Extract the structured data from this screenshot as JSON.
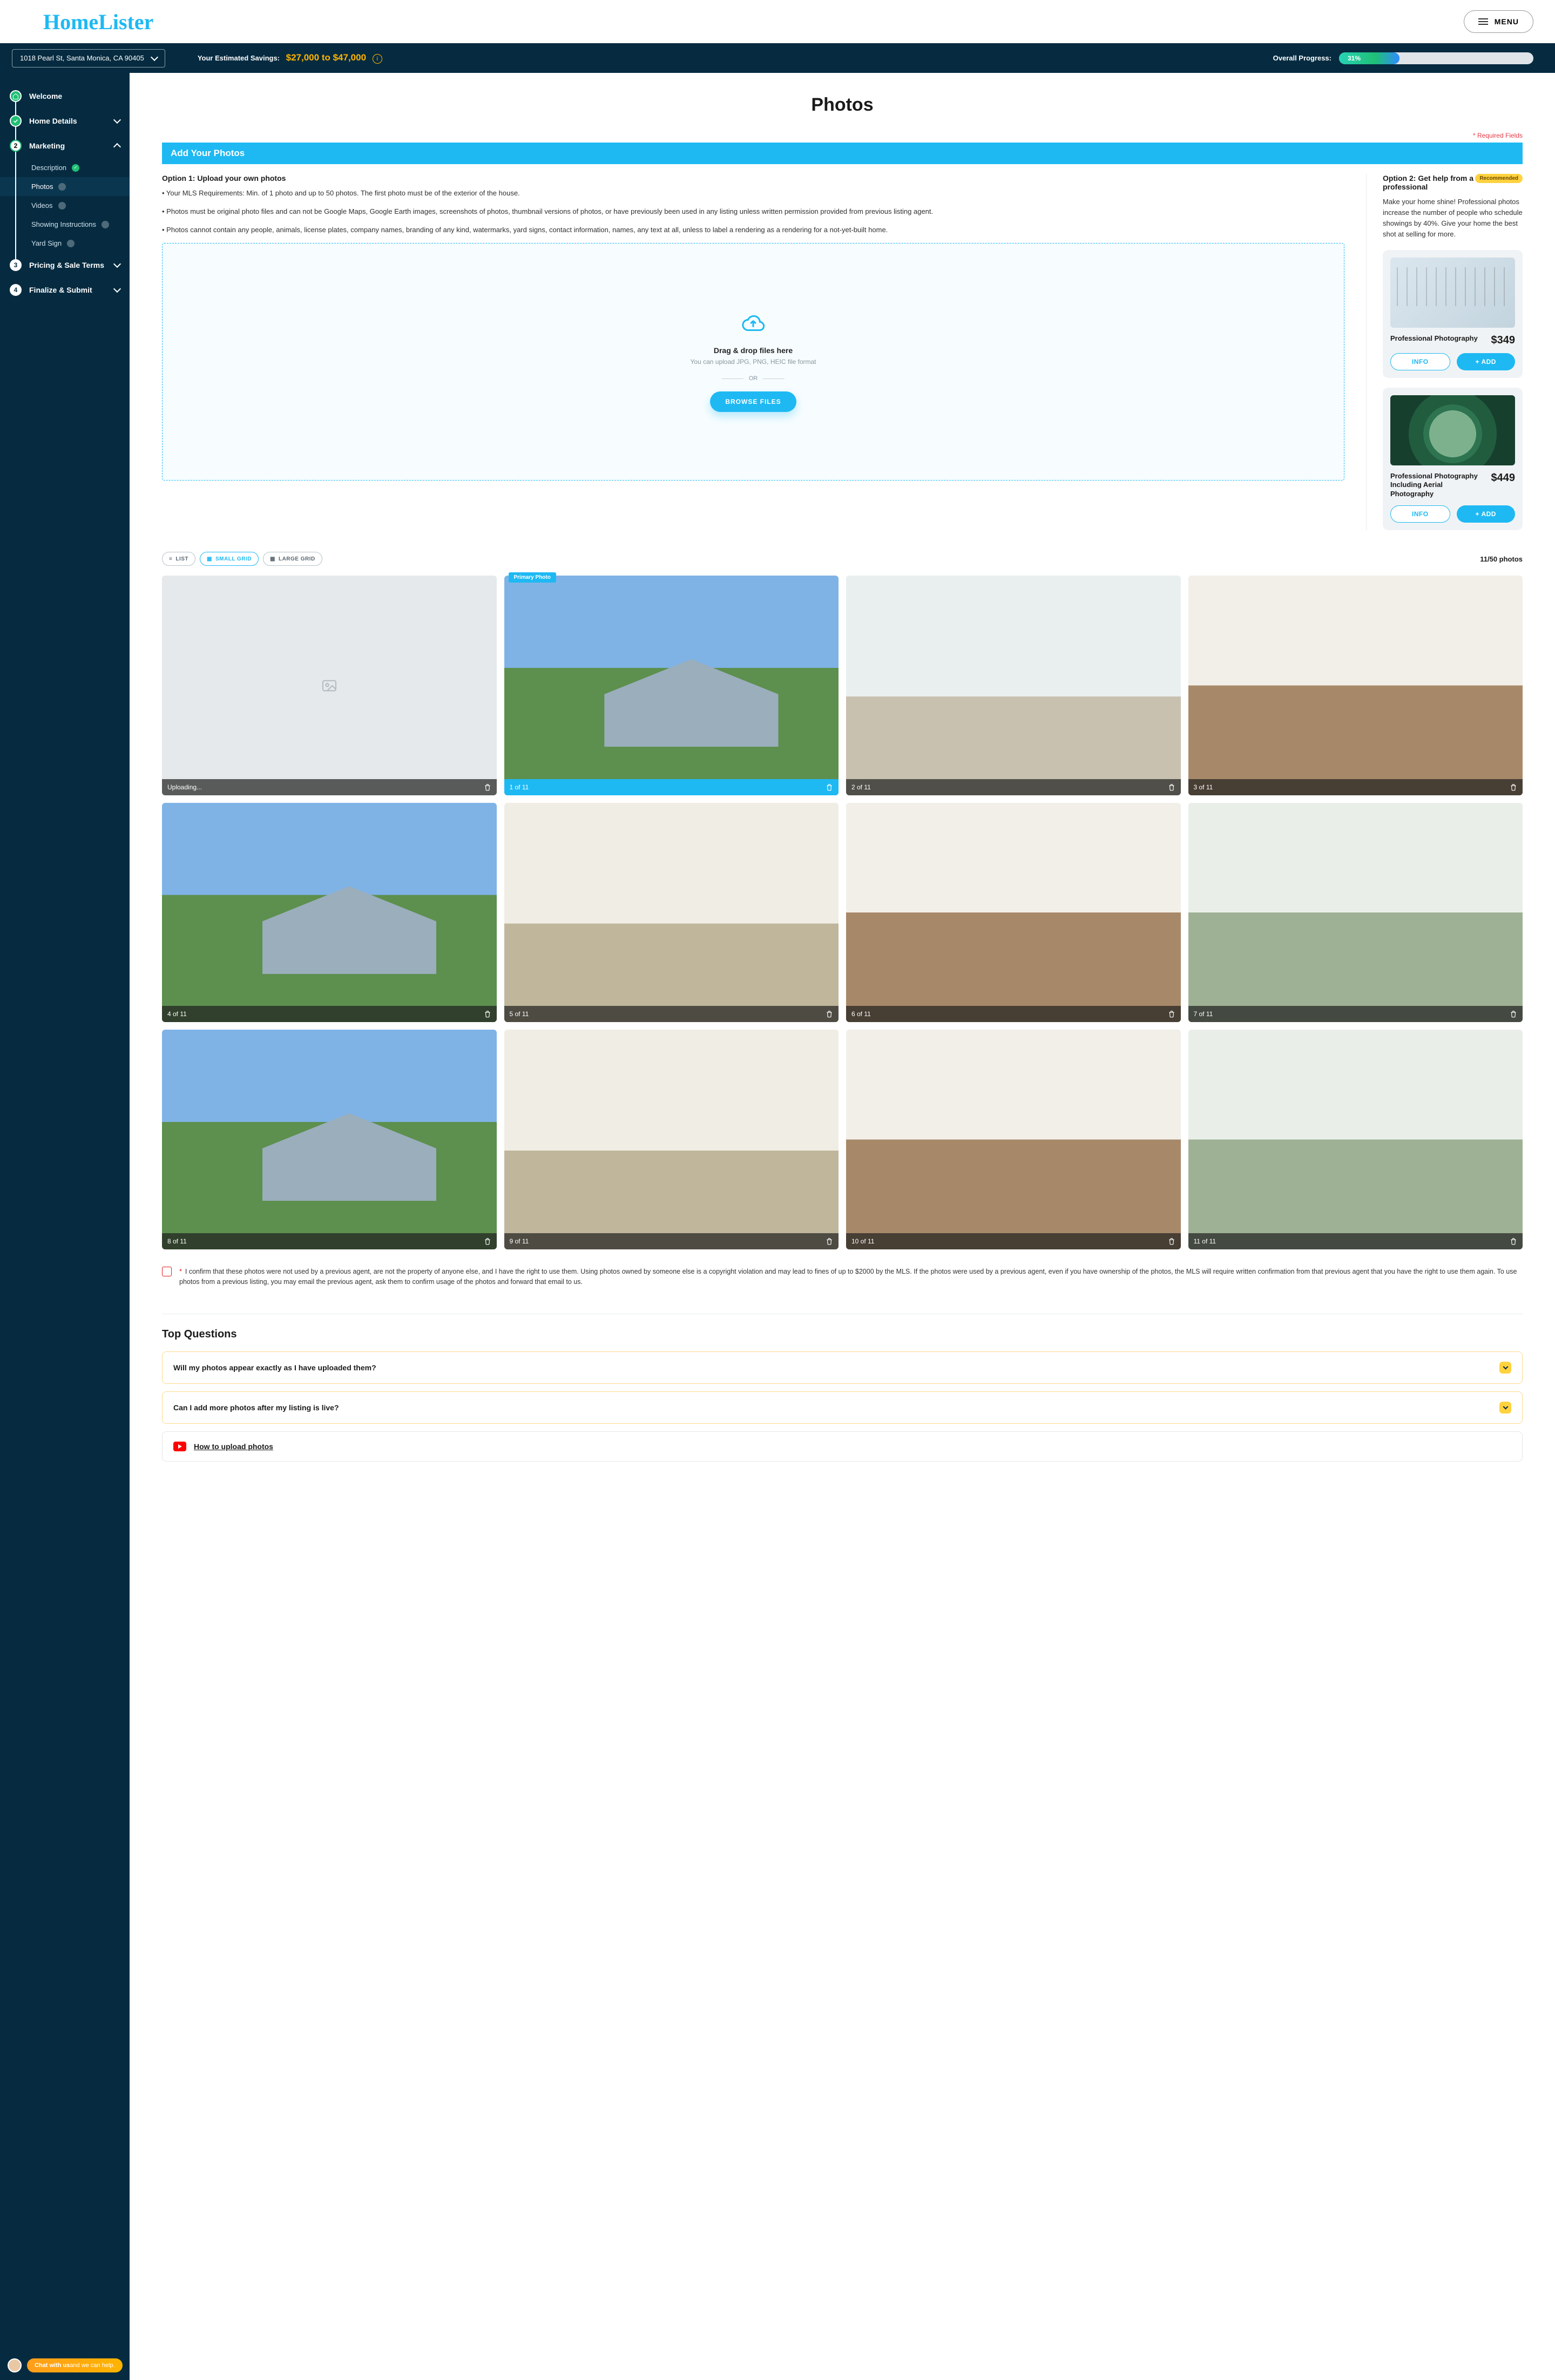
{
  "header": {
    "logo": "HomeLister",
    "menu": "MENU"
  },
  "subheader": {
    "address": "1018 Pearl St, Santa Monica, CA 90405",
    "savings_label": "Your Estimated Savings:",
    "savings_value": "$27,000 to $47,000",
    "progress_label": "Overall Progress:",
    "progress_percent": "31%",
    "progress_width": "31%"
  },
  "sidebar": {
    "steps": {
      "welcome": "Welcome",
      "home_details": "Home Details",
      "marketing": "Marketing",
      "pricing": "Pricing & Sale Terms",
      "finalize": "Finalize & Submit",
      "n3": "3",
      "n4": "4",
      "n2": "2"
    },
    "sub": {
      "description": "Description",
      "photos": "Photos",
      "videos": "Videos",
      "showing": "Showing Instructions",
      "yard": "Yard Sign"
    }
  },
  "page": {
    "title": "Photos",
    "required": "* Required Fields",
    "section": "Add Your Photos"
  },
  "option1": {
    "title": "Option 1: Upload your own photos",
    "p1": "• Your MLS Requirements: Min. of 1 photo and up to 50 photos. The first photo must be of the exterior of the house.",
    "p2": "• Photos must be original photo files and can not be Google Maps, Google Earth images, screenshots of photos, thumbnail versions of photos, or have previously been used in any listing unless written permission provided from previous listing agent.",
    "p3": "• Photos cannot contain any people, animals, license plates, company names, branding of any kind, watermarks, yard signs, contact information, names, any text at all, unless to label a rendering as a rendering for a not-yet-built home."
  },
  "upload": {
    "title": "Drag & drop files here",
    "sub": "You can upload JPG, PNG, HEIC file format",
    "or": "OR",
    "browse": "BROWSE FILES"
  },
  "option2": {
    "title": "Option 2: Get help from a professional",
    "badge": "Recommended",
    "body": "Make your home shine! Professional photos increase the number of people who schedule showings by 40%. Give your home the best shot at selling for more."
  },
  "addons": [
    {
      "name": "Professional Photography",
      "price": "$349",
      "info": "INFO",
      "add": "+ ADD"
    },
    {
      "name": "Professional Photography Including Aerial Photography",
      "price": "$449",
      "info": "INFO",
      "add": "+ ADD"
    }
  ],
  "toolbar": {
    "list": "LIST",
    "small": "SMALL GRID",
    "large": "LARGE GRID",
    "count": "11/50 photos"
  },
  "photos": {
    "uploading": "Uploading...",
    "primary": "Primary Photo",
    "labels": [
      "1 of 11",
      "2 of 11",
      "3 of 11",
      "4 of 11",
      "5 of 11",
      "6 of 11",
      "7 of 11",
      "8 of 11",
      "9 of 11",
      "10 of 11",
      "11 of 11"
    ]
  },
  "confirm": {
    "text": "I confirm that these photos were not used by a previous agent, are not the property of anyone else, and I have the right to use them. Using photos owned by someone else is a copyright violation and may lead to fines of up to $2000 by the MLS. If the photos were used by a previous agent, even if you have ownership of the photos, the MLS will require written confirmation from that previous agent that you have the right to use them again. To use photos from a previous listing, you may email the previous agent, ask them to confirm usage of the photos and forward that email to us."
  },
  "faq": {
    "title": "Top Questions",
    "q1": "Will my photos appear exactly as I have uploaded them?",
    "q2": "Can I add more photos after my listing is live?",
    "video": "How to upload photos"
  },
  "chat": {
    "a": "Chat with us",
    "b": " and we can help."
  }
}
